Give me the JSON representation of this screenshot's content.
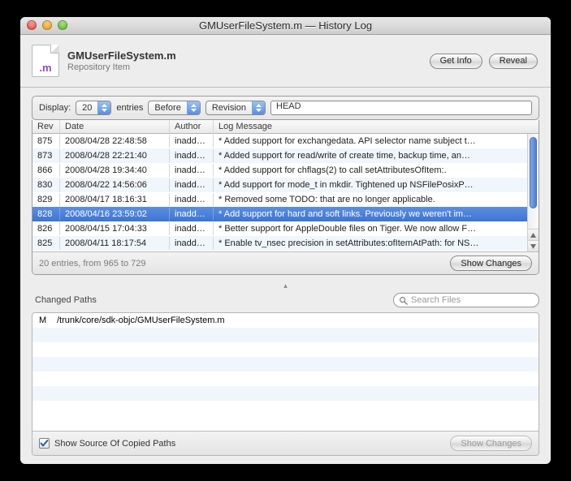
{
  "window": {
    "title": "GMUserFileSystem.m — History Log"
  },
  "header": {
    "filename": "GMUserFileSystem.m",
    "subtitle": "Repository Item",
    "get_info_label": "Get Info",
    "reveal_label": "Reveal"
  },
  "filter": {
    "display_label": "Display:",
    "count": "20",
    "entries_label": "entries",
    "direction": "Before",
    "mode": "Revision",
    "rev_value": "HEAD"
  },
  "columns": {
    "rev": "Rev",
    "date": "Date",
    "author": "Author",
    "msg": "Log Message"
  },
  "rows": [
    {
      "rev": "875",
      "date": "2008/04/28 22:48:58",
      "author": "inaddran",
      "msg": "* Added support for exchangedata. API selector name subject t…",
      "selected": false
    },
    {
      "rev": "873",
      "date": "2008/04/28 22:21:40",
      "author": "inaddran",
      "msg": "* Added support for read/write of create time, backup time, an…",
      "selected": false
    },
    {
      "rev": "866",
      "date": "2008/04/28 19:34:40",
      "author": "inaddran",
      "msg": "* Added support for chflags(2) to call setAttributesOfItem:.",
      "selected": false
    },
    {
      "rev": "830",
      "date": "2008/04/22 14:56:06",
      "author": "inaddran",
      "msg": "* Add support for mode_t in mkdir. Tightened up NSFilePosixP…",
      "selected": false
    },
    {
      "rev": "829",
      "date": "2008/04/17 18:16:31",
      "author": "inaddran",
      "msg": "* Removed some TODO: that are no longer applicable.",
      "selected": false
    },
    {
      "rev": "828",
      "date": "2008/04/16 23:59:02",
      "author": "inaddran",
      "msg": "* Add support for hard and soft links. Previously we weren't im…",
      "selected": true
    },
    {
      "rev": "826",
      "date": "2008/04/15 17:04:33",
      "author": "inaddran",
      "msg": "* Better support for AppleDouble files on Tiger. We now allow F…",
      "selected": false
    },
    {
      "rev": "825",
      "date": "2008/04/11 18:17:54",
      "author": "inaddran",
      "msg": "* Enable tv_nsec precision in setAttributes:ofItemAtPath: for NS…",
      "selected": false
    }
  ],
  "footer": {
    "status": "20 entries, from 965 to 729",
    "show_changes_label": "Show Changes"
  },
  "paths": {
    "heading": "Changed Paths",
    "search_placeholder": "Search Files",
    "rows": [
      {
        "status": "M",
        "path": "/trunk/core/sdk-objc/GMUserFileSystem.m"
      }
    ],
    "checkbox_label": "Show Source Of Copied Paths",
    "checkbox_checked": true,
    "show_changes_label": "Show Changes"
  },
  "chart_data": null
}
